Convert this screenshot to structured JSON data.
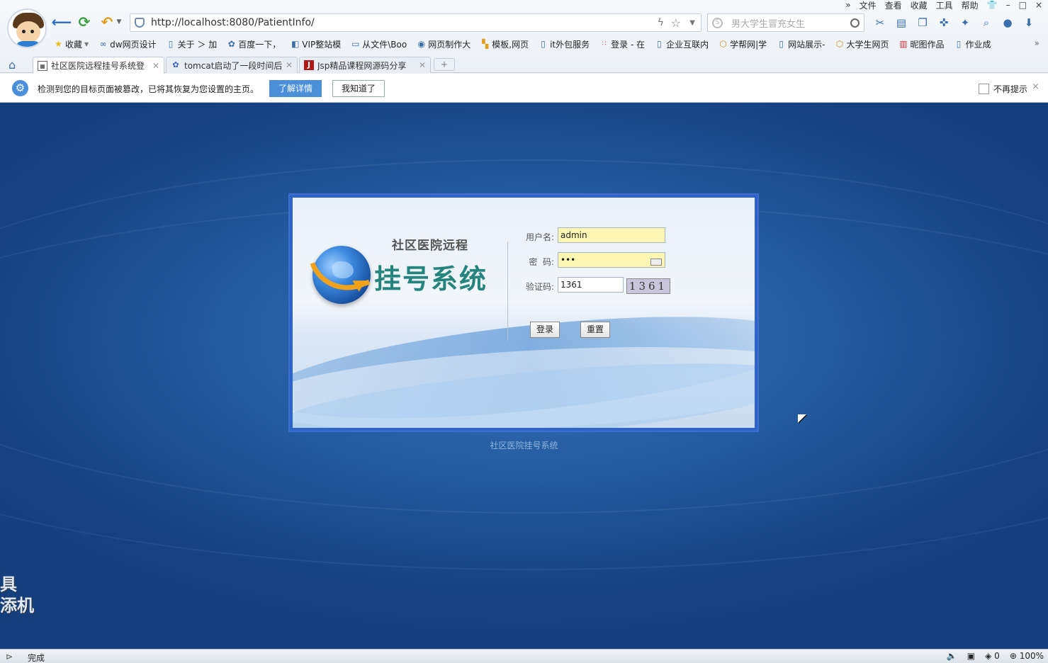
{
  "browser": {
    "menu": [
      "»",
      "文件",
      "查看",
      "收藏",
      "工具",
      "帮助"
    ],
    "window_controls": [
      "👕",
      "–",
      "□",
      "×"
    ],
    "url": "http://localhost:8080/PatientInfo/",
    "search_placeholder": "男大学生冒充女生",
    "bookmarks": [
      {
        "label": "收藏",
        "icon": "star-icon"
      },
      {
        "label": "dw网页设计",
        "icon": "link-icon"
      },
      {
        "label": "关于 ＞ 加",
        "icon": "page-icon"
      },
      {
        "label": "百度一下，",
        "icon": "baidu-paw-icon"
      },
      {
        "label": "VIP整站模",
        "icon": "vip-icon"
      },
      {
        "label": "从文件\\Boo",
        "icon": "folder-icon"
      },
      {
        "label": "网页制作大",
        "icon": "globe-icon"
      },
      {
        "label": "模板,网页",
        "icon": "template-icon"
      },
      {
        "label": "it外包服务",
        "icon": "page-icon"
      },
      {
        "label": "登录 - 在",
        "icon": "login-icon"
      },
      {
        "label": "企业互联内",
        "icon": "page-icon"
      },
      {
        "label": "学帮网|学",
        "icon": "cube-icon"
      },
      {
        "label": "网站展示-",
        "icon": "page-icon"
      },
      {
        "label": "大学生网页",
        "icon": "cube-icon"
      },
      {
        "label": "昵图作品",
        "icon": "nitu-icon"
      },
      {
        "label": "作业成",
        "icon": "page-icon"
      }
    ],
    "bookmarks_more": "»",
    "tabs": [
      {
        "label": "社区医院远程挂号系统登",
        "active": true
      },
      {
        "label": "tomcat启动了一段时间后",
        "active": false
      },
      {
        "label": "Jsp精品课程网源码分享",
        "active": false
      }
    ],
    "new_tab": "+"
  },
  "notice": {
    "message": "检测到您的目标页面被篡改，已将其恢复为您设置的主页。",
    "learn_more": "了解详情",
    "got_it": "我知道了",
    "dont_show": "不再提示",
    "close": "×"
  },
  "login": {
    "subtitle": "社区医院远程",
    "title": "挂号系统",
    "username_label": "用户名:",
    "username_value": "admin",
    "password_label": "密  码:",
    "password_value": "•••",
    "captcha_label": "验证码:",
    "captcha_input": "1361",
    "captcha_image_text": "1361",
    "login_button": "登录",
    "reset_button": "重置"
  },
  "footer": "社区医院挂号系统",
  "side_badge": [
    "具",
    "添机"
  ],
  "status": {
    "text": "完成",
    "blocked_count": "0",
    "zoom": "100%"
  },
  "colors": {
    "page_bg": "#1a4a8e",
    "title_teal": "#26847f",
    "accent_blue": "#4a8fd8",
    "input_yellow": "#fbf6b2"
  }
}
